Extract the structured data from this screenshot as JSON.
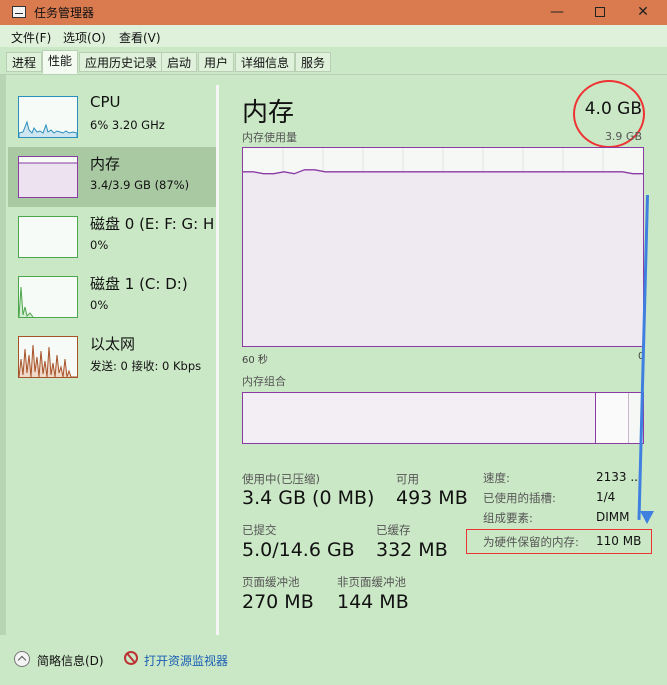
{
  "window": {
    "title": "任务管理器"
  },
  "menu": {
    "items": [
      "文件(F)",
      "选项(O)",
      "查看(V)"
    ]
  },
  "tabs": [
    "进程",
    "性能",
    "应用历史记录",
    "启动",
    "用户",
    "详细信息",
    "服务"
  ],
  "active_tab": "性能",
  "sidebar": {
    "items": [
      {
        "name": "CPU",
        "sub": "6% 3.20 GHz",
        "color": "#2a8fbe"
      },
      {
        "name": "内存",
        "sub": "3.4/3.9 GB (87%)",
        "color": "#8a3ba4",
        "selected": true
      },
      {
        "name": "磁盘 0 (E: F: G: H:",
        "sub": "0%",
        "color": "#4ca64c"
      },
      {
        "name": "磁盘 1 (C: D:)",
        "sub": "0%",
        "color": "#4ca64c"
      },
      {
        "name": "以太网",
        "sub": "发送: 0 接收: 0 Kbps",
        "color": "#a7532a"
      }
    ]
  },
  "main": {
    "title": "内存",
    "total": "4.0 GB",
    "usage_label": "内存使用量",
    "usage_max": "3.9 GB",
    "time_left": "60 秒",
    "time_right": "0",
    "composition_label": "内存组合"
  },
  "stats": {
    "in_use_label": "使用中(已压缩)",
    "in_use_value": "3.4 GB (0 MB)",
    "available_label": "可用",
    "available_value": "493 MB",
    "committed_label": "已提交",
    "committed_value": "5.0/14.6 GB",
    "cached_label": "已缓存",
    "cached_value": "332 MB",
    "paged_label": "页面缓冲池",
    "paged_value": "270 MB",
    "nonpaged_label": "非页面缓冲池",
    "nonpaged_value": "144 MB"
  },
  "info": {
    "speed_label": "速度:",
    "speed_value": "2133 ...",
    "slots_label": "已使用的插槽:",
    "slots_value": "1/4",
    "form_label": "组成要素:",
    "form_value": "DIMM",
    "reserved_label": "为硬件保留的内存:",
    "reserved_value": "110 MB"
  },
  "footer": {
    "less_details": "简略信息(D)",
    "open_monitor": "打开资源监视器"
  },
  "colors": {
    "memory": "#8a3ba4",
    "annotation_red": "#e33333",
    "annotation_blue": "#3f7fe0"
  },
  "usage_series_percent": [
    88,
    88,
    87,
    87,
    88,
    87,
    89,
    89,
    88,
    88,
    88,
    88,
    88,
    88,
    88,
    88,
    88,
    88,
    88,
    88,
    88,
    88,
    88,
    88,
    88,
    88,
    88,
    88,
    88,
    88,
    88,
    88,
    88,
    88,
    88,
    88,
    88,
    88,
    87,
    87
  ]
}
